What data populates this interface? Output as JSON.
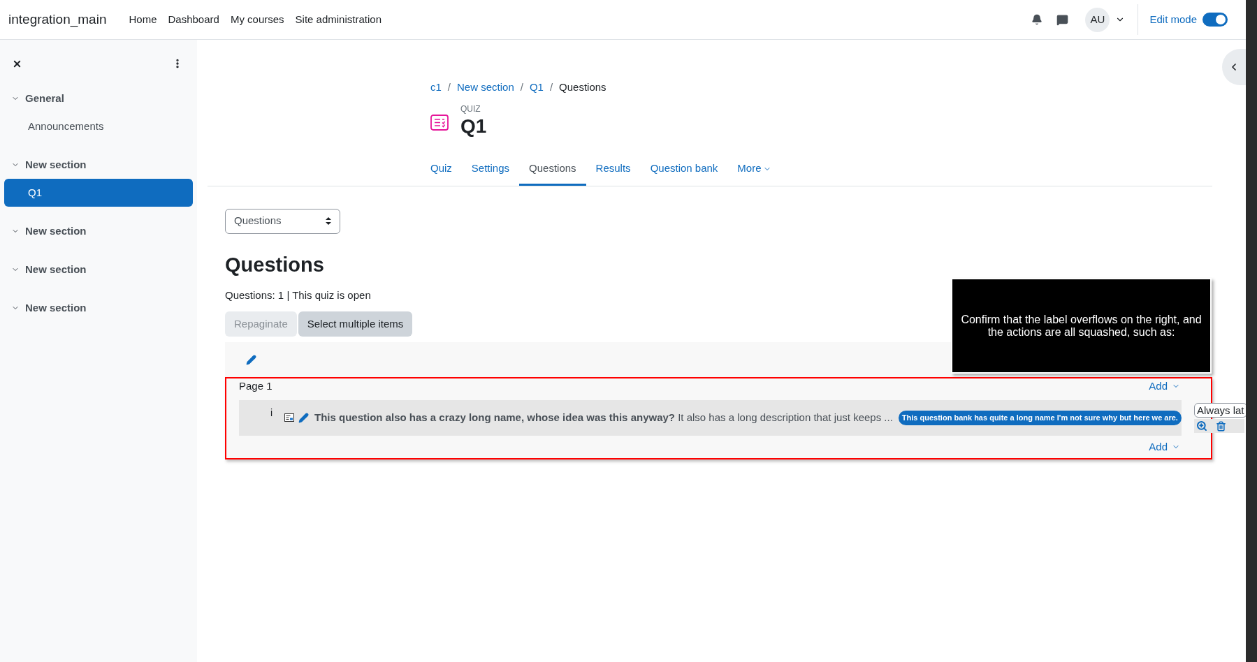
{
  "navbar": {
    "brand": "integration_main",
    "links": [
      "Home",
      "Dashboard",
      "My courses",
      "Site administration"
    ],
    "avatar": "AU",
    "edit_mode": {
      "label": "Edit mode",
      "on": true
    }
  },
  "sidebar": {
    "sections": [
      {
        "title": "General",
        "expanded": true,
        "items": [
          {
            "label": "Announcements",
            "selected": false
          }
        ]
      },
      {
        "title": "New section",
        "expanded": true,
        "items": [
          {
            "label": "Q1",
            "selected": true
          }
        ]
      },
      {
        "title": "New section",
        "expanded": true
      },
      {
        "title": "New section",
        "expanded": true
      },
      {
        "title": "New section",
        "expanded": true
      }
    ]
  },
  "breadcrumb": [
    {
      "kind": "item",
      "label": "c1",
      "link": true
    },
    {
      "kind": "separator",
      "label": "/"
    },
    {
      "kind": "item",
      "label": "New section",
      "link": true
    },
    {
      "kind": "separator",
      "label": "/"
    },
    {
      "kind": "item",
      "label": "Q1",
      "link": true
    },
    {
      "kind": "separator",
      "label": "/"
    },
    {
      "kind": "item",
      "label": "Questions",
      "link": false
    }
  ],
  "activity": {
    "type_label": "QUIZ",
    "title": "Q1"
  },
  "tabs": [
    {
      "label": "Quiz",
      "selected": false,
      "menu": false
    },
    {
      "label": "Settings",
      "selected": false,
      "menu": false
    },
    {
      "label": "Questions",
      "selected": true,
      "menu": false
    },
    {
      "label": "Results",
      "selected": false,
      "menu": false
    },
    {
      "label": "Question bank",
      "selected": false,
      "menu": false
    },
    {
      "label": "More",
      "selected": false,
      "menu": true
    }
  ],
  "view_select": {
    "value": "Questions"
  },
  "heading": "Questions",
  "info": "Questions: 1 | This quiz is open",
  "buttons": [
    {
      "label": "Repaginate",
      "disabled": true
    },
    {
      "label": "Select multiple items",
      "disabled": false
    }
  ],
  "page": {
    "label": "Page 1",
    "add_top": "Add",
    "add_bottom": "Add",
    "question": {
      "number": "i",
      "name": "This question also has a crazy long name, whose idea was this anyway?",
      "description": "It also has a long description that just keeps ...",
      "bank_badge": "This question bank has quite a long name I'm not sure why but here we are.",
      "version_select": "Always lat"
    }
  },
  "annotation": {
    "text": "Confirm that the label overflows on the right, and the actions are all squashed, such as:"
  }
}
